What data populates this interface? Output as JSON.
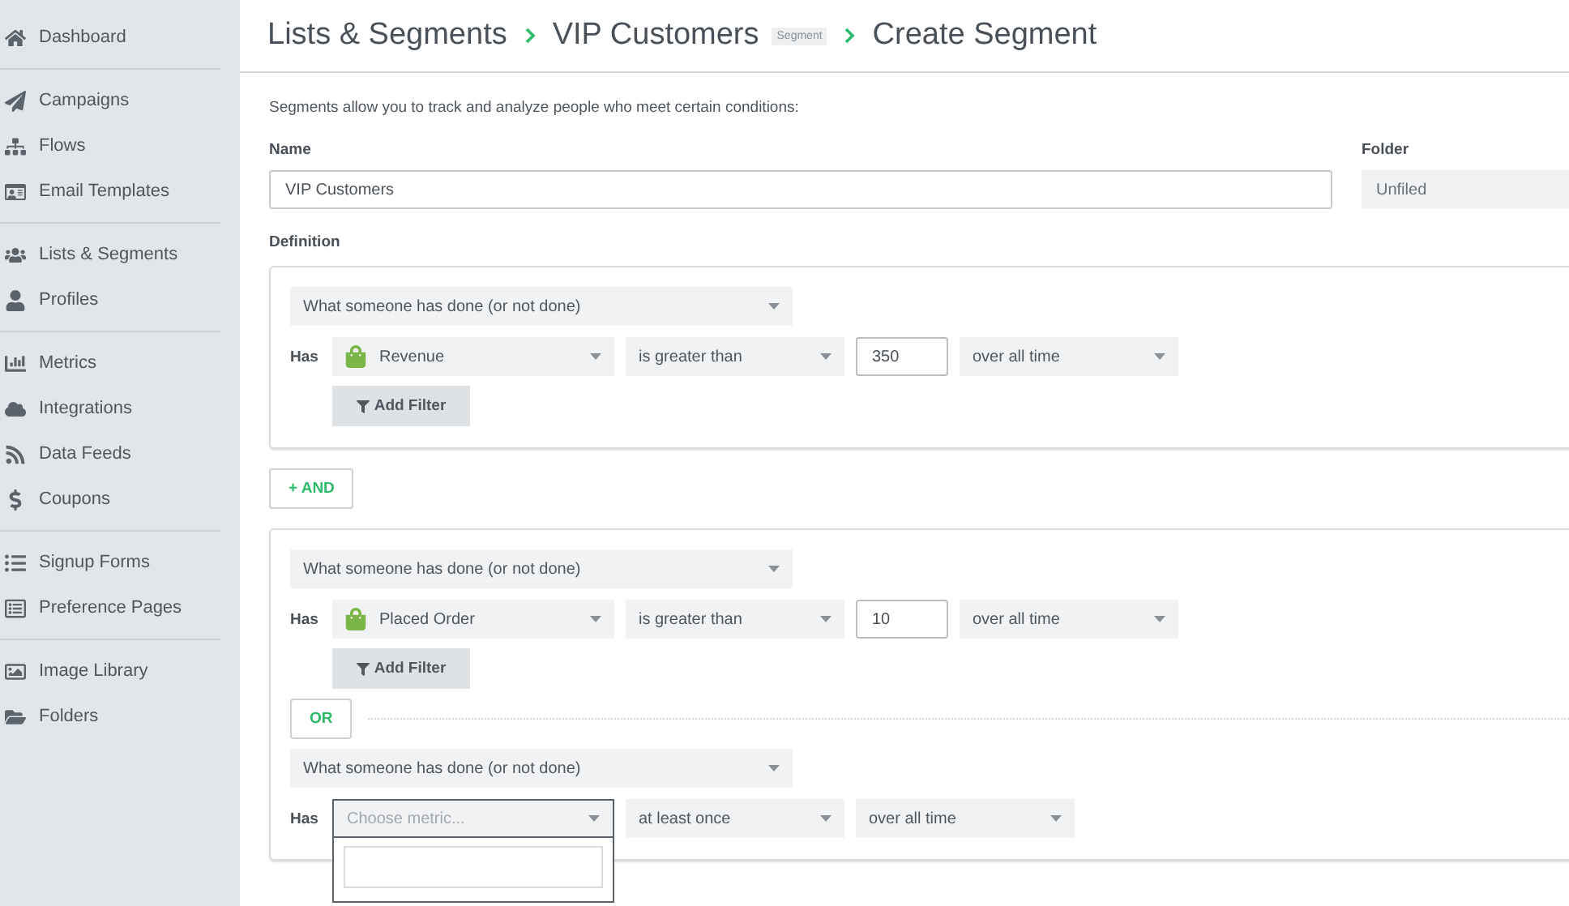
{
  "sidebar": {
    "groups": [
      {
        "items": [
          {
            "label": "Dashboard"
          }
        ]
      },
      {
        "items": [
          {
            "label": "Campaigns"
          },
          {
            "label": "Flows"
          },
          {
            "label": "Email Templates"
          }
        ]
      },
      {
        "items": [
          {
            "label": "Lists & Segments"
          },
          {
            "label": "Profiles"
          }
        ]
      },
      {
        "items": [
          {
            "label": "Metrics"
          },
          {
            "label": "Integrations"
          },
          {
            "label": "Data Feeds"
          },
          {
            "label": "Coupons"
          }
        ]
      },
      {
        "items": [
          {
            "label": "Signup Forms"
          },
          {
            "label": "Preference Pages"
          }
        ]
      },
      {
        "items": [
          {
            "label": "Image Library"
          },
          {
            "label": "Folders"
          }
        ]
      }
    ]
  },
  "breadcrumb": [
    {
      "label": "Lists & Segments"
    },
    {
      "label": "VIP Customers",
      "badge": "Segment"
    },
    {
      "label": "Create Segment"
    }
  ],
  "intro": "Segments allow you to track and analyze people who meet certain conditions:",
  "name_field": {
    "label": "Name",
    "value": "VIP Customers"
  },
  "folder_field": {
    "label": "Folder",
    "value": "Unfiled"
  },
  "definition": {
    "label": "Definition",
    "and_button": "+ AND",
    "groups": [
      {
        "conditions": [
          {
            "type": "What someone has done (or not done)",
            "has": "Has",
            "metric": "Revenue",
            "operator": "is greater than",
            "value": "350",
            "timeframe": "over all time",
            "add_filter": "Add Filter"
          }
        ]
      },
      {
        "conditions": [
          {
            "type": "What someone has done (or not done)",
            "has": "Has",
            "metric": "Placed Order",
            "operator": "is greater than",
            "value": "10",
            "timeframe": "over all time",
            "add_filter": "Add Filter"
          },
          {
            "joiner": "OR",
            "type": "What someone has done (or not done)",
            "has": "Has",
            "metric_placeholder": "Choose metric...",
            "metric_open": true,
            "operator": "at least once",
            "timeframe": "over all time"
          }
        ]
      }
    ]
  }
}
